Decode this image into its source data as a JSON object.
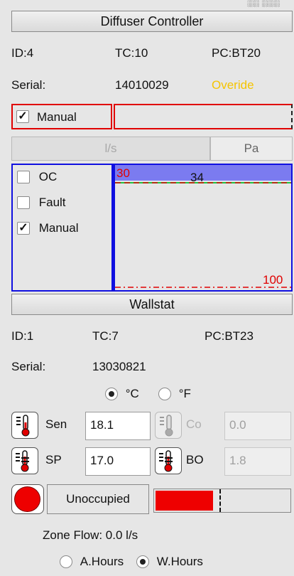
{
  "top_clip": "░░ ░░░",
  "diffuser": {
    "title": "Diffuser Controller",
    "id": "ID:4",
    "tc": "TC:10",
    "pc": "PC:BT20",
    "serial_label": "Serial:",
    "serial_value": "14010029",
    "override": "Overide",
    "manual_label": "Manual",
    "manual_checked": true,
    "unit_ls": "l/s",
    "unit_pa": "Pa",
    "checks": [
      {
        "label": "OC",
        "checked": false
      },
      {
        "label": "Fault",
        "checked": false
      },
      {
        "label": "Manual",
        "checked": true
      }
    ],
    "plot": {
      "setpoint": "30",
      "value": "34",
      "max": "100"
    },
    "colors": {
      "plot_fill": "#7b7bf0",
      "plot_border": "#1010e0",
      "setpoint": "#e00000",
      "value_line": "#20c040"
    }
  },
  "wallstat": {
    "title": "Wallstat",
    "id": "ID:1",
    "tc": "TC:7",
    "pc": "PC:BT23",
    "serial_label": "Serial:",
    "serial_value": "13030821",
    "unit_c": "°C",
    "unit_f": "°F",
    "unit_selected": "C",
    "sen_label": "Sen",
    "sen_value": "18.1",
    "co_label": "Co",
    "co_value": "0.0",
    "sp_label": "SP",
    "sp_value": "17.0",
    "bo_label": "BO",
    "bo_value": "1.8",
    "occupancy": "Unoccupied",
    "occupancy_level": 0.5,
    "zone_flow": "Zone Flow: 0.0 l/s",
    "hours_a": "A.Hours",
    "hours_w": "W.Hours",
    "hours_selected": "W.Hours",
    "colors": {
      "occupancy": "#ee0000",
      "override": "#f5c400"
    }
  }
}
